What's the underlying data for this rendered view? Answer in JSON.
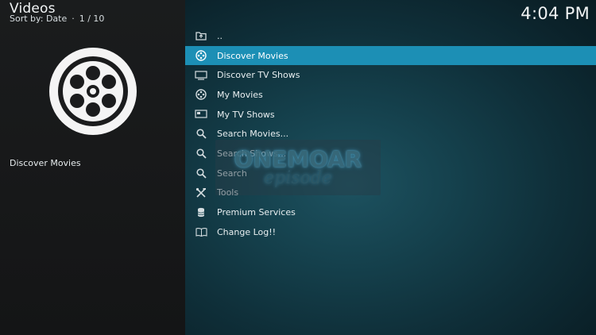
{
  "header": {
    "title": "Videos",
    "sort_label": "Sort by: Date",
    "separator": "·",
    "position": "1 / 10"
  },
  "clock": "4:04 PM",
  "info": {
    "poster_icon": "film-reel-icon",
    "selected_label": "Discover Movies"
  },
  "list": {
    "items": [
      {
        "label": "..",
        "icon": "parent-folder-icon"
      },
      {
        "label": "Discover Movies",
        "icon": "film-reel-icon",
        "focused": true
      },
      {
        "label": "Discover TV Shows",
        "icon": "tv-icon"
      },
      {
        "label": "My Movies",
        "icon": "film-reel-icon"
      },
      {
        "label": "My TV Shows",
        "icon": "tv-icon"
      },
      {
        "label": "Search Movies...",
        "icon": "search-icon"
      },
      {
        "label": "Search Shows...",
        "icon": "search-icon"
      },
      {
        "label": "Search",
        "icon": "search-icon"
      },
      {
        "label": "Tools",
        "icon": "tools-icon"
      },
      {
        "label": "Premium Services",
        "icon": "database-icon"
      },
      {
        "label": "Change Log!!",
        "icon": "book-icon"
      }
    ]
  },
  "watermark": {
    "line1": "ONEMOAR",
    "line2": "episode"
  },
  "colors": {
    "focus_bar": "#1c8fb5",
    "left_panel": "#1a1c1d",
    "right_bg": "#15414d"
  }
}
